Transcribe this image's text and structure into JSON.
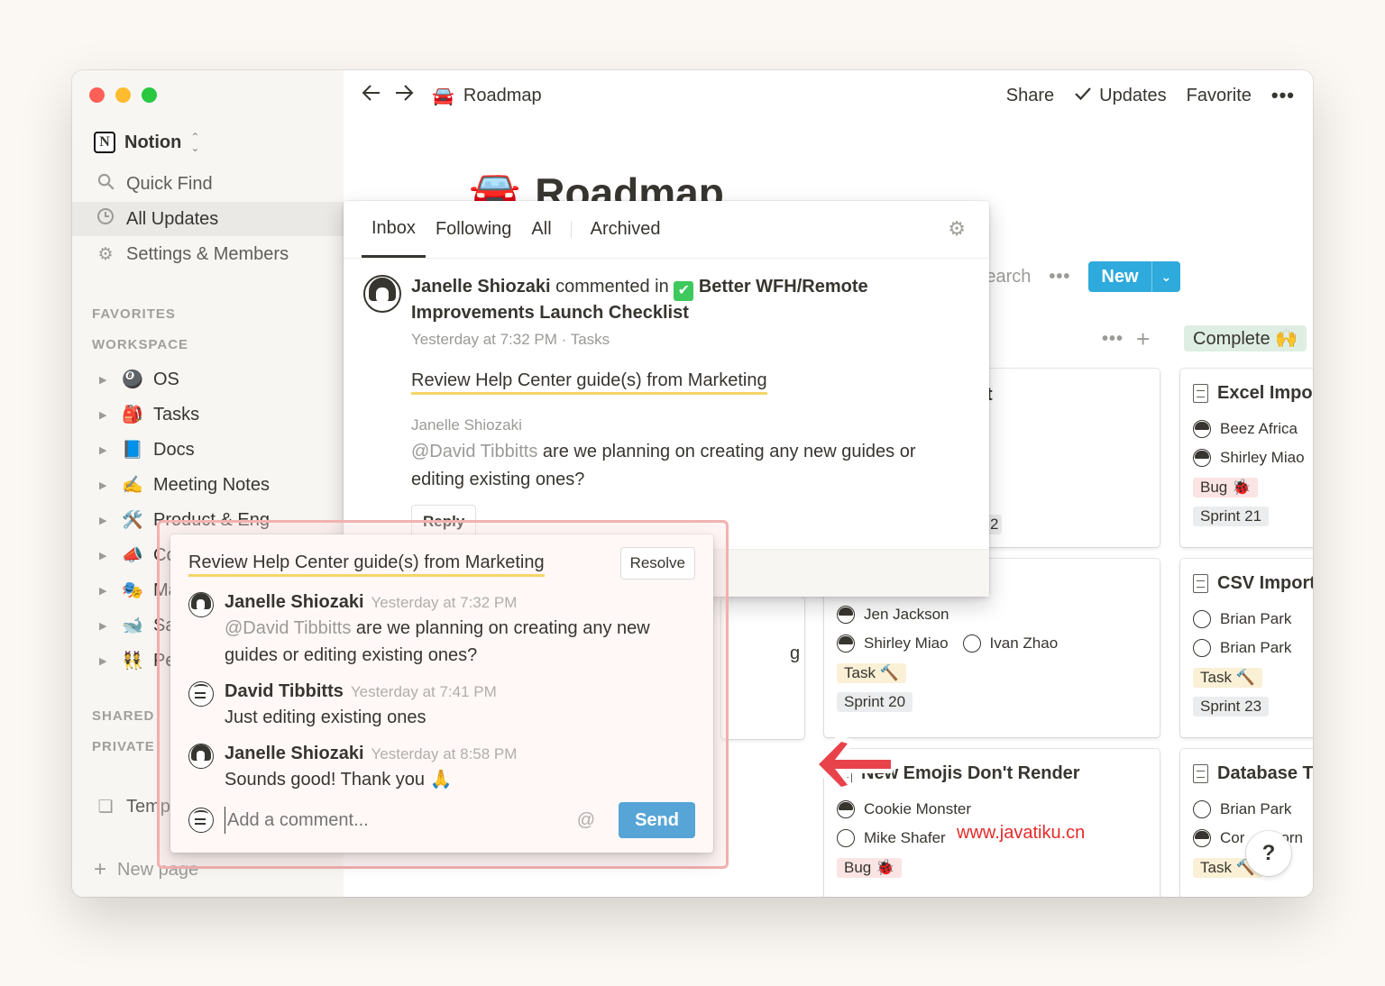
{
  "window": {
    "traffic_lights": [
      "close",
      "minimize",
      "zoom"
    ]
  },
  "sidebar": {
    "workspace": "Notion",
    "nav": [
      {
        "label": "Quick Find",
        "icon": "search-icon"
      },
      {
        "label": "All Updates",
        "icon": "clock-icon",
        "active": true
      },
      {
        "label": "Settings & Members",
        "icon": "gear-icon"
      }
    ],
    "sections": {
      "favorites": "FAVORITES",
      "workspace": "WORKSPACE",
      "shared": "SHARED",
      "private": "PRIVATE"
    },
    "tree": [
      {
        "label": "OS",
        "emoji": "🎱"
      },
      {
        "label": "Tasks",
        "emoji": "🎒"
      },
      {
        "label": "Docs",
        "emoji": "📘"
      },
      {
        "label": "Meeting Notes",
        "emoji": "✍️"
      },
      {
        "label": "Product & Eng",
        "emoji": "🛠️"
      },
      {
        "label": "Co",
        "emoji": "📣"
      },
      {
        "label": "Ma",
        "emoji": "🎭"
      },
      {
        "label": "Sa",
        "emoji": "🐋"
      },
      {
        "label": "Pe",
        "emoji": "👯"
      }
    ],
    "templates_label": "Temp",
    "new_page": "New page"
  },
  "topbar": {
    "breadcrumb_emoji": "🚘",
    "breadcrumb": "Roadmap",
    "share": "Share",
    "updates": "Updates",
    "favorite": "Favorite"
  },
  "page": {
    "title_emoji": "🚘",
    "title": "Roadmap",
    "search": "Search",
    "new_button": "New"
  },
  "board": {
    "column_badge": "Complete 🙌",
    "cards": [
      {
        "title": "Excel Impor",
        "people": [
          "Beez Africa",
          "Shirley Miao"
        ],
        "tags": [
          "Bug 🐞",
          "Sprint 21"
        ]
      },
      {
        "title": "CSV Import",
        "people": [
          "Brian Park",
          "Brian Park"
        ],
        "tags": [
          "Task 🔨",
          "Sprint 23"
        ]
      },
      {
        "title": "Database T",
        "people": [
          "Brian Park",
          "Cor"
        ],
        "tags": [
          "Task 🔨"
        ]
      },
      {
        "title": "New Emojis Don't Render",
        "people": [
          "Cookie Monster",
          "Mike Shafer"
        ],
        "tags": [
          "Bug 🐞"
        ]
      },
      {
        "title": "",
        "people": [
          "Jen Jackson",
          "Shirley Miao",
          "Ivan Zhao"
        ],
        "tags": [
          "Task 🔨",
          "Sprint 20"
        ]
      }
    ],
    "partial_card_1_char": "t",
    "partial_card_2_char": "2",
    "partial_card_3_char": "g",
    "partial_text_orn": "orn"
  },
  "updates_panel": {
    "tabs": [
      "Inbox",
      "Following",
      "All",
      "Archived"
    ],
    "active_tab": "Inbox",
    "item": {
      "author": "Janelle Shiozaki",
      "action": "commented in",
      "page_icon": "✅",
      "page": "Better WFH/Remote Improvements Launch Checklist",
      "meta": "Yesterday at 7:32 PM · Tasks",
      "quote": "Review Help Center guide(s) from Marketing",
      "comment_author": "Janelle Shiozaki",
      "mention": "@David Tibbitts",
      "comment": " are we planning on creating any new guides or editing existing ones?",
      "reply": "Reply"
    }
  },
  "discussion": {
    "quote": "Review Help Center guide(s) from Marketing",
    "resolve": "Resolve",
    "comments": [
      {
        "author": "Janelle Shiozaki",
        "time": "Yesterday at 7:32 PM",
        "mention": "@David Tibbitts",
        "text": " are we planning on creating any new guides or editing existing ones?"
      },
      {
        "author": "David Tibbitts",
        "time": "Yesterday at 7:41 PM",
        "mention": "",
        "text": "Just editing existing ones"
      },
      {
        "author": "Janelle Shiozaki",
        "time": "Yesterday at 8:58 PM",
        "mention": "",
        "text": "Sounds good! Thank you 🙏"
      }
    ],
    "placeholder": "Add a comment...",
    "at": "@",
    "send": "Send"
  },
  "watermark": "www.javatiku.cn",
  "help": "?",
  "colors": {
    "accent": "#2eaadc",
    "send": "#56a5d6",
    "highlight_border": "#f2b2b0",
    "arrow": "#e8434b",
    "watermark": "#e62a2a"
  }
}
